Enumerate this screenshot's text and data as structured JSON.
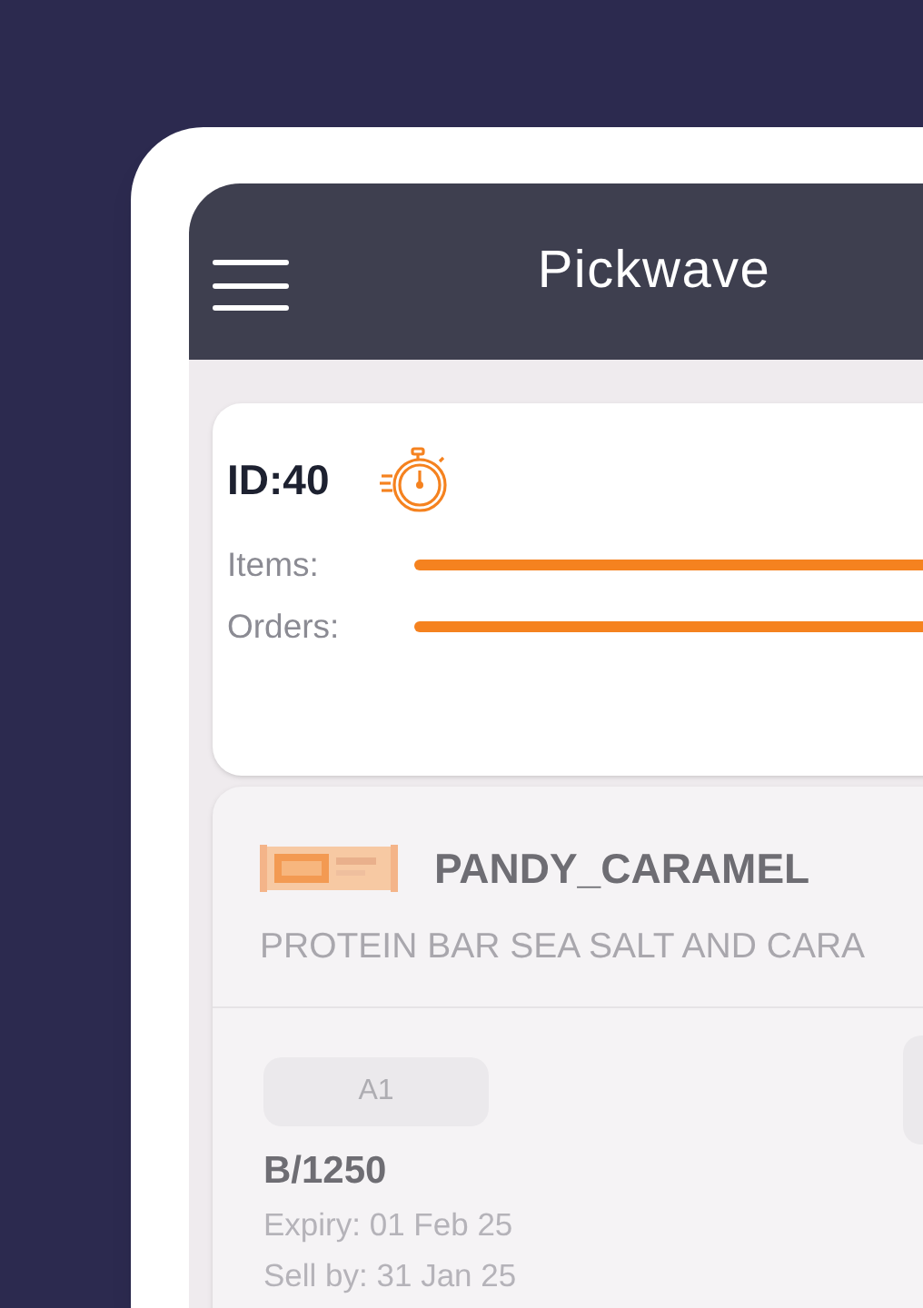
{
  "app_bar": {
    "title": "Pickwave"
  },
  "wave": {
    "id": "ID:40",
    "progress": [
      {
        "label": "Items:"
      },
      {
        "label": "Orders:"
      }
    ]
  },
  "product": {
    "name": "PANDY_CARAMEL",
    "description": "PROTEIN BAR SEA SALT AND CARA",
    "location": "A1",
    "batch": "B/1250",
    "expiry": "Expiry: 01 Feb 25",
    "sell_by": "Sell by: 31 Jan 25"
  }
}
